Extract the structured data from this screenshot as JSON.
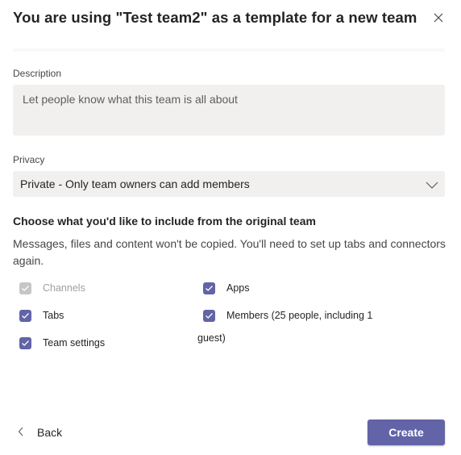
{
  "dialog": {
    "title": "You are using \"Test team2\" as a template for a new team",
    "close_icon": "close-icon"
  },
  "description": {
    "label": "Description",
    "placeholder": "Let people know what this team is all about",
    "value": ""
  },
  "privacy": {
    "label": "Privacy",
    "selected": "Private - Only team owners can add members",
    "icon": "chevron-down-icon"
  },
  "include": {
    "heading": "Choose what you'd like to include from the original team",
    "hint": "Messages, files and content won't be copied. You'll need to set up tabs and connectors again.",
    "options": [
      {
        "label": "Channels",
        "checked": true,
        "disabled": true
      },
      {
        "label": "Apps",
        "checked": true,
        "disabled": false
      },
      {
        "label": "Tabs",
        "checked": true,
        "disabled": false
      },
      {
        "label": "Members (25 people, including 1",
        "label_cont": "guest)",
        "checked": true,
        "disabled": false
      },
      {
        "label": "Team settings",
        "checked": true,
        "disabled": false
      }
    ]
  },
  "footer": {
    "back_label": "Back",
    "create_label": "Create"
  },
  "colors": {
    "accent": "#6264a7",
    "disabled_check": "#c8c6c4",
    "field_bg": "#f1f0ef"
  }
}
